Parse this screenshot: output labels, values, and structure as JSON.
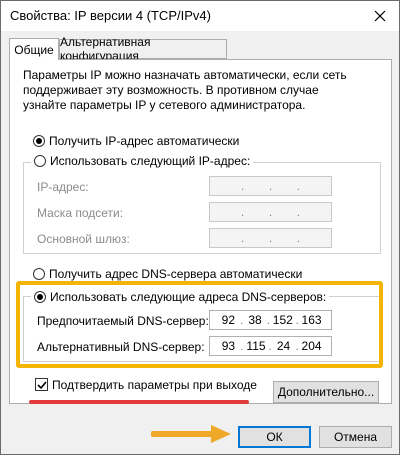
{
  "window": {
    "title": "Свойства: IP версии 4 (TCP/IPv4)"
  },
  "tabs": [
    {
      "label": "Общие"
    },
    {
      "label": "Альтернативная конфигурация"
    }
  ],
  "description": "Параметры IP можно назначать автоматически, если сеть поддерживает эту возможность. В противном случае узнайте параметры IP у сетевого администратора.",
  "ip": {
    "auto_label": "Получить IP-адрес автоматически",
    "manual_label": "Использовать следующий IP-адрес:",
    "auto_selected": true,
    "fields": [
      {
        "label": "IP-адрес:",
        "octets": [
          "",
          "",
          "",
          ""
        ]
      },
      {
        "label": "Маска подсети:",
        "octets": [
          "",
          "",
          "",
          ""
        ]
      },
      {
        "label": "Основной шлюз:",
        "octets": [
          "",
          "",
          "",
          ""
        ]
      }
    ]
  },
  "dns": {
    "auto_label": "Получить адрес DNS-сервера автоматически",
    "manual_label": "Использовать следующие адреса DNS-серверов:",
    "manual_selected": true,
    "preferred": {
      "label": "Предпочитаемый DNS-сервер:",
      "octets": [
        "92",
        "38",
        "152",
        "163"
      ]
    },
    "alternate": {
      "label": "Альтернативный DNS-сервер:",
      "octets": [
        "93",
        "115",
        "24",
        "204"
      ]
    }
  },
  "validate": {
    "label": "Подтвердить параметры при выходе",
    "checked": true
  },
  "buttons": {
    "advanced": "Дополнительно...",
    "ok": "ОК",
    "cancel": "Отмена"
  },
  "colors": {
    "highlight": "#f5b400",
    "underline": "#e23b3b",
    "arrow": "#f0a828",
    "default_button_border": "#0078d7"
  }
}
